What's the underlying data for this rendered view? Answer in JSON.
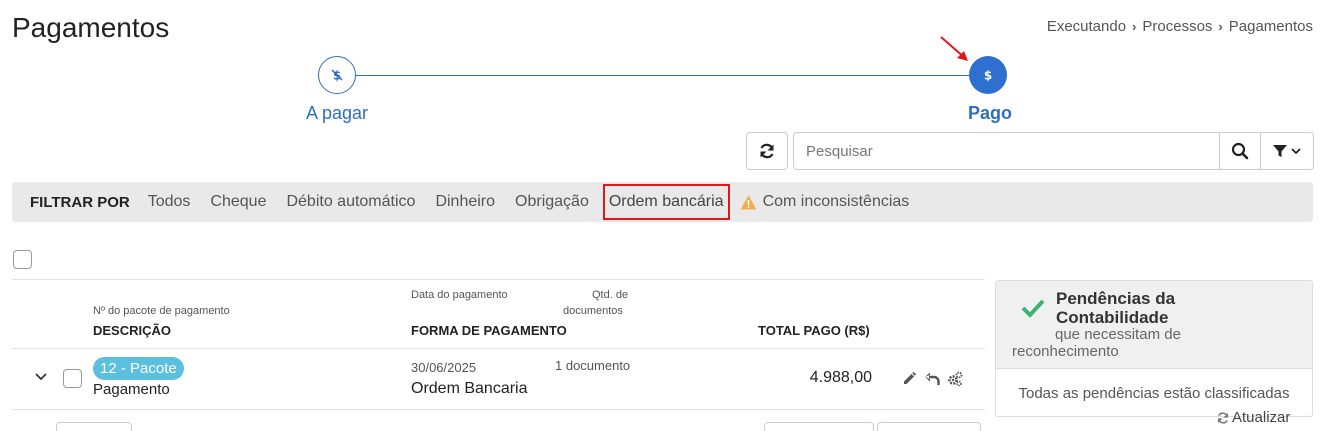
{
  "page": {
    "title": "Pagamentos"
  },
  "breadcrumb": [
    "Executando",
    "Processos",
    "Pagamentos"
  ],
  "stepper": {
    "steps": [
      {
        "label": "A pagar",
        "icon": "dollar-slash-icon",
        "active": false
      },
      {
        "label": "Pago",
        "icon": "dollar-icon",
        "active": true
      }
    ]
  },
  "search": {
    "placeholder": "Pesquisar"
  },
  "filters": {
    "label": "FILTRAR POR",
    "items": [
      "Todos",
      "Cheque",
      "Débito automático",
      "Dinheiro",
      "Obrigação",
      "Ordem bancária"
    ],
    "selected": "Ordem bancária",
    "warning_item": "Com inconsistências"
  },
  "table": {
    "headers": {
      "package_number": "Nº do pacote de pagamento",
      "description": "DESCRIÇÃO",
      "payment_date": "Data do pagamento",
      "docs_qty_line1": "Qtd. de",
      "docs_qty_line2": "documentos",
      "payment_method": "FORMA DE PAGAMENTO",
      "total_paid": "TOTAL PAGO (R$)"
    },
    "rows": [
      {
        "package": "12 - Pacote",
        "description": "Pagamento",
        "date": "30/06/2025",
        "docs": "1 documento",
        "method": "Ordem Bancaria",
        "total": "4.988,00"
      }
    ]
  },
  "accounting": {
    "title": "Pendências da Contabilidade",
    "subtitle_line1": "que necessitam de",
    "subtitle_line2": "reconhecimento",
    "body": "Todas as pendências estão classificadas",
    "refresh_label": "Atualizar"
  },
  "colors": {
    "primary": "#2f6fbe",
    "active_step": "#2e6fd0",
    "badge": "#5ac0de",
    "highlight_border": "#e01818",
    "success": "#3cb371",
    "warning": "#f0ad4e"
  }
}
